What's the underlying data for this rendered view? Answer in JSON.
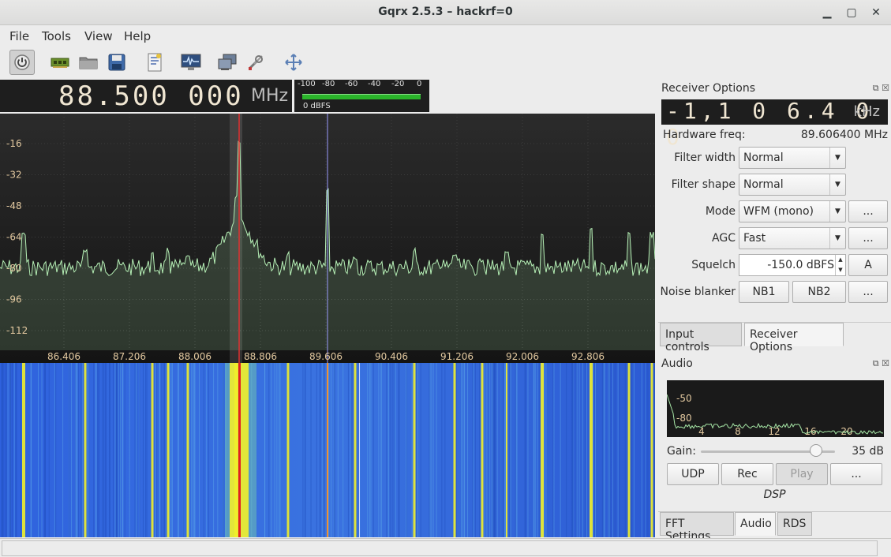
{
  "window": {
    "title": "Gqrx 2.5.3 – hackrf=0"
  },
  "menu": {
    "file": "File",
    "tools": "Tools",
    "view": "View",
    "help": "Help"
  },
  "toolbar_icons": [
    "power-icon",
    "hardware-icon",
    "folder-icon",
    "save-icon",
    "notes-icon",
    "waveform-icon",
    "network-icon",
    "tools-icon",
    "fullscreen-icon"
  ],
  "freq_display": {
    "value": "88.500 000",
    "unit": "MHz"
  },
  "meter": {
    "ticks": [
      "-100",
      "-80",
      "-60",
      "-40",
      "-20",
      "0"
    ],
    "label": "0 dBFS"
  },
  "spectrum": {
    "y_ticks": [
      "-16",
      "-32",
      "-48",
      "-64",
      "-80",
      "-96",
      "-112"
    ],
    "x_ticks": [
      "86.406",
      "87.206",
      "88.006",
      "88.806",
      "89.606",
      "90.406",
      "91.206",
      "92.006",
      "92.806"
    ]
  },
  "receiver_options": {
    "header": "Receiver Options",
    "offset_value": "-1,1 0 6.4 0 0",
    "offset_unit": "kHz",
    "hw_freq_label": "Hardware freq:",
    "hw_freq_value": "89.606400 MHz",
    "filter_width_label": "Filter width",
    "filter_width_value": "Normal",
    "filter_shape_label": "Filter shape",
    "filter_shape_value": "Normal",
    "mode_label": "Mode",
    "mode_value": "WFM (mono)",
    "agc_label": "AGC",
    "agc_value": "Fast",
    "squelch_label": "Squelch",
    "squelch_value": "-150.0 dBFS",
    "squelch_auto": "A",
    "noise_blanker_label": "Noise blanker",
    "nb1": "NB1",
    "nb2": "NB2",
    "more": "..."
  },
  "tabs_top": {
    "input_controls": "Input controls",
    "receiver_options": "Receiver Options"
  },
  "audio": {
    "header": "Audio",
    "y_ticks": [
      "-50",
      "-80"
    ],
    "x_ticks": [
      "4",
      "8",
      "12",
      "16",
      "20"
    ],
    "gain_label": "Gain:",
    "gain_value": "35 dB",
    "gain_fraction": 0.86,
    "udp": "UDP",
    "rec": "Rec",
    "play": "Play",
    "more": "...",
    "dsp_label": "DSP"
  },
  "tabs_bottom": {
    "fft_settings": "FFT Settings",
    "audio": "Audio",
    "rds": "RDS"
  }
}
